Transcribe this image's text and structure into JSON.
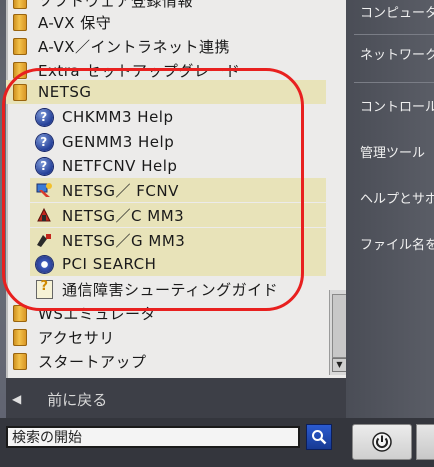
{
  "programs_menu": {
    "items": [
      {
        "label": "ソフトウェア登録情報",
        "icon": "folder-icon",
        "indent": false,
        "highlight": false
      },
      {
        "label": "A-VX 保守",
        "icon": "folder-icon",
        "indent": false,
        "highlight": false
      },
      {
        "label": "A-VX／イントラネット連携",
        "icon": "folder-icon",
        "indent": false,
        "highlight": false
      },
      {
        "label": "Extra セットアップグレード",
        "icon": "folder-icon",
        "indent": false,
        "highlight": false
      },
      {
        "label": "NETSG",
        "icon": "folder-icon",
        "indent": false,
        "highlight": true
      },
      {
        "label": "CHKMM3 Help",
        "icon": "help-icon",
        "indent": true,
        "highlight": false
      },
      {
        "label": "GENMM3 Help",
        "icon": "help-icon",
        "indent": true,
        "highlight": false
      },
      {
        "label": "NETFCNV Help",
        "icon": "help-icon",
        "indent": true,
        "highlight": false
      },
      {
        "label": "NETSG／ FCNV",
        "icon": "netsg-fcnv-icon",
        "indent": true,
        "highlight": true
      },
      {
        "label": "NETSG／C MM3",
        "icon": "netsg-c-icon",
        "indent": true,
        "highlight": true
      },
      {
        "label": "NETSG／G MM3",
        "icon": "netsg-g-icon",
        "indent": true,
        "highlight": true
      },
      {
        "label": "PCI SEARCH",
        "icon": "pci-search-icon",
        "indent": true,
        "highlight": true
      },
      {
        "label": "通信障害シューティングガイド",
        "icon": "guide-icon",
        "indent": true,
        "highlight": false
      },
      {
        "label": "WSエミュレータ",
        "icon": "folder-icon",
        "indent": false,
        "highlight": false
      },
      {
        "label": "アクセサリ",
        "icon": "folder-icon",
        "indent": false,
        "highlight": false
      },
      {
        "label": "スタートアップ",
        "icon": "folder-icon",
        "indent": false,
        "highlight": false
      }
    ],
    "back_label": "前に戻る",
    "back_icon": "left-triangle-icon"
  },
  "right_pane": {
    "items": [
      {
        "label": "コンピュータ"
      },
      {
        "label": "ネットワーク"
      },
      {
        "label": "コントロール"
      },
      {
        "label": "管理ツール"
      },
      {
        "label": "ヘルプとサポ"
      },
      {
        "label": "ファイル名を"
      }
    ]
  },
  "search": {
    "placeholder": "検索の開始",
    "button_icon": "search-icon"
  },
  "power": {
    "icon": "power-icon"
  },
  "colors": {
    "highlight": "#e8e3b9",
    "annotation": "#e8201f",
    "menu_bg": "#ecebea"
  }
}
